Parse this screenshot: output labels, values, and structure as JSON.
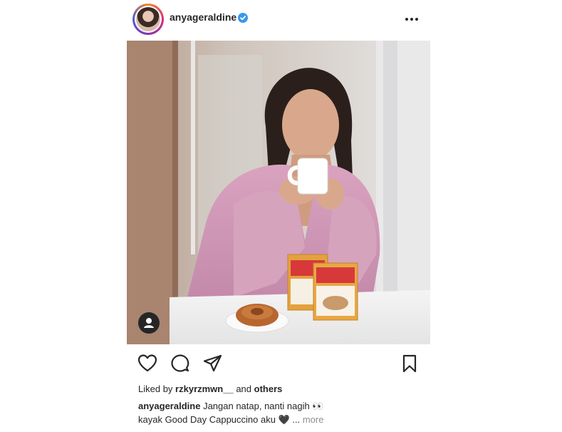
{
  "header": {
    "username": "anyageraldine",
    "verified": true,
    "verified_icon": "verified-badge-icon",
    "more_icon": "more-options-icon"
  },
  "photo": {
    "subject": "woman in pink blouse holding white coffee mug at table",
    "products": [
      "Good Day",
      "Cappuccino"
    ],
    "tag_icon": "user-tag-icon"
  },
  "actions": {
    "like_icon": "heart-icon",
    "comment_icon": "comment-icon",
    "share_icon": "send-icon",
    "save_icon": "bookmark-icon"
  },
  "likes": {
    "prefix": "Liked by",
    "user": "rzkyrzmwn__",
    "connector": "and",
    "others": "others"
  },
  "caption": {
    "username": "anyageraldine",
    "text_line1": "Jangan natap, nanti nagih 👀",
    "text_line2": "kayak Good Day Cappuccino aku 🖤",
    "ellipsis": "...",
    "more": "more"
  },
  "colors": {
    "text": "#262626",
    "muted": "#8e8e8e",
    "verified": "#3897f0"
  }
}
